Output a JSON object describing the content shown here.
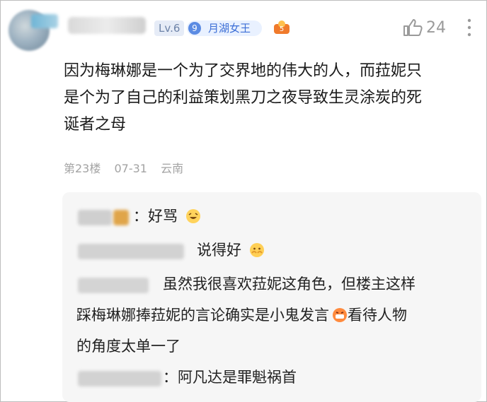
{
  "post": {
    "level": "Lv.6",
    "fan_badge": {
      "level": "9",
      "title": "月湖女王"
    },
    "likes": "24",
    "content_lines": [
      "因为梅琳娜是一个为了交界地的伟大的人，而菈妮只",
      "是个为了自己的利益策划黑刀之夜导致生灵涂炭的死",
      "诞者之母"
    ],
    "floor": "第23楼",
    "date": "07-31",
    "location": "云南"
  },
  "replies": [
    {
      "text": "：好骂"
    },
    {
      "text": "说得好"
    },
    {
      "lines": [
        "虽然我很喜欢菈妮这角色，但楼主这样",
        "踩梅琳娜捧菈妮的言论确实是小鬼发言",
        "看待人物",
        "的角度太单一了"
      ]
    },
    {
      "text": "：阿凡达是罪魁祸首"
    }
  ],
  "icons": {
    "like": "thumbs-up-icon",
    "more": "more-vertical-icon",
    "gift": "gift-badge-icon",
    "emoji_laugh": "laughing-emoji-icon",
    "emoji_clap": "clapping-emoji-icon",
    "emoji_grin": "grinning-emoji-icon"
  },
  "colors": {
    "accent_blue": "#3d6fd6",
    "meta_gray": "#a3a3a3"
  }
}
